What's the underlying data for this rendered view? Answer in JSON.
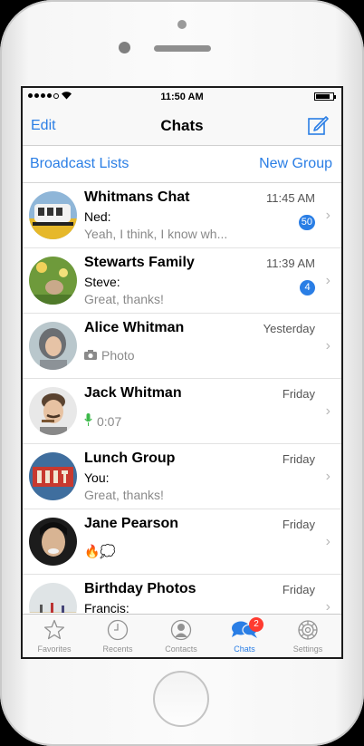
{
  "status_bar": {
    "time": "11:50 AM",
    "battery_level": 0.85
  },
  "nav": {
    "edit_label": "Edit",
    "title": "Chats"
  },
  "subnav": {
    "broadcast_label": "Broadcast Lists",
    "new_group_label": "New Group"
  },
  "chats": [
    {
      "name": "Whitmans Chat",
      "time": "11:45 AM",
      "sender": "Ned:",
      "preview": "Yeah, I think, I know wh...",
      "unread": "50"
    },
    {
      "name": "Stewarts Family",
      "time": "11:39 AM",
      "sender": "Steve:",
      "preview": "Great, thanks!",
      "unread": "4"
    },
    {
      "name": "Alice Whitman",
      "time": "Yesterday",
      "preview": "Photo",
      "icon": "camera-icon"
    },
    {
      "name": "Jack Whitman",
      "time": "Friday",
      "preview": "0:07",
      "icon": "microphone-icon"
    },
    {
      "name": "Lunch Group",
      "time": "Friday",
      "sender": "You:",
      "preview": "Great, thanks!"
    },
    {
      "name": "Jane Pearson",
      "time": "Friday",
      "preview": "🔥💭"
    },
    {
      "name": "Birthday Photos",
      "time": "Friday",
      "sender": "Francis:"
    }
  ],
  "tabs": [
    {
      "label": "Favorites",
      "icon": "star-icon"
    },
    {
      "label": "Recents",
      "icon": "clock-icon"
    },
    {
      "label": "Contacts",
      "icon": "person-icon"
    },
    {
      "label": "Chats",
      "icon": "chat-bubbles-icon",
      "badge": "2",
      "active": true
    },
    {
      "label": "Settings",
      "icon": "gear-icon"
    }
  ],
  "colors": {
    "accent": "#2a7ee5",
    "badge_red": "#ff3b30"
  }
}
